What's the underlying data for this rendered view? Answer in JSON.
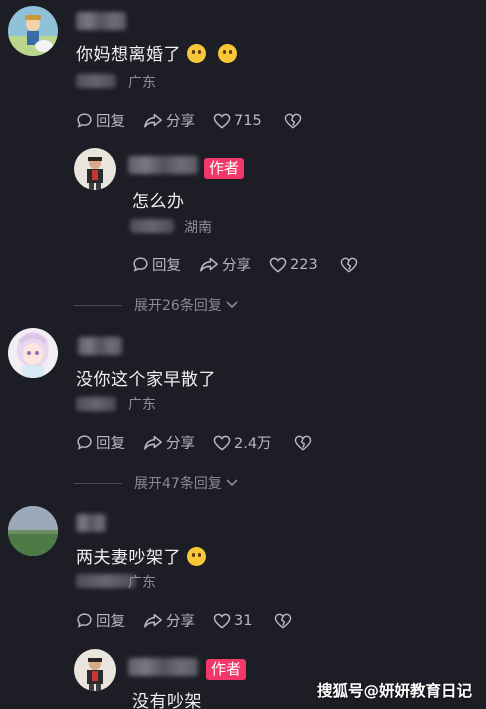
{
  "comments": [
    {
      "text": "你妈想离婚了",
      "location": "广东",
      "reply_label": "回复",
      "share_label": "分享",
      "likes": "715",
      "reply": {
        "author_badge": "作者",
        "text": "怎么办",
        "location": "湖南",
        "reply_label": "回复",
        "share_label": "分享",
        "likes": "223"
      },
      "expand_label": "展开26条回复"
    },
    {
      "text": "没你这个家早散了",
      "location": "广东",
      "reply_label": "回复",
      "share_label": "分享",
      "likes": "2.4万",
      "expand_label": "展开47条回复"
    },
    {
      "text": "两夫妻吵架了",
      "location": "广东",
      "reply_label": "回复",
      "share_label": "分享",
      "likes": "31",
      "reply": {
        "author_badge": "作者",
        "text": "没有吵架"
      }
    }
  ],
  "watermark": "搜狐号@妍妍教育日记",
  "colors": {
    "background": "#1d1d26",
    "author_badge": "#f2386a",
    "secondary_text": "#8e8e98"
  },
  "icons": [
    "comment-icon",
    "share-icon",
    "heart-icon",
    "broken-heart-icon",
    "chevron-down-icon"
  ]
}
